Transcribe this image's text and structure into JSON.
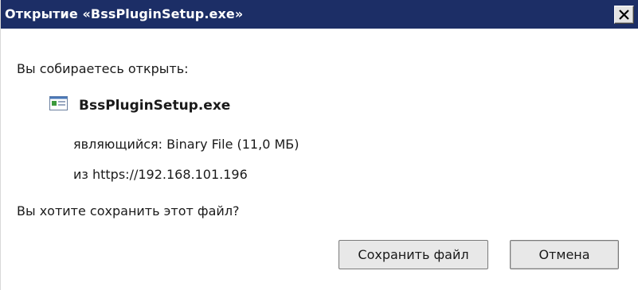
{
  "dialog": {
    "title": "Открытие «BssPluginSetup.exe»",
    "prompt_open": "Вы собираетесь открыть:",
    "file": {
      "icon": "executable-file-icon",
      "name": "BssPluginSetup.exe",
      "type_line": "являющийся: Binary File (11,0 МБ)",
      "source_line": "из https://192.168.101.196"
    },
    "question": "Вы хотите сохранить этот файл?",
    "buttons": {
      "save_label": "Сохранить файл",
      "cancel_label": "Отмена"
    },
    "colors": {
      "titlebar": "#1c2e66",
      "title_text": "#ffffff"
    }
  }
}
